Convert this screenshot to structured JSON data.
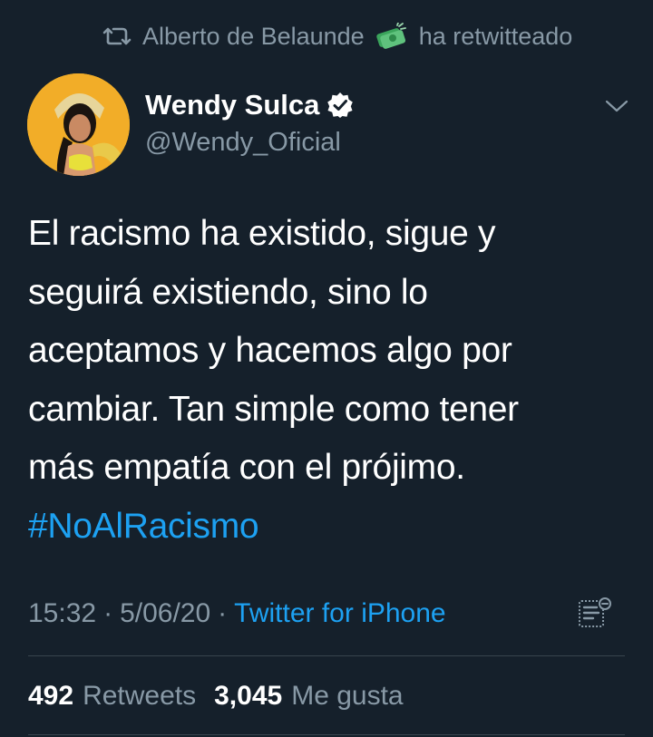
{
  "retweet_header": {
    "user": "Alberto de Belaunde",
    "action": "ha retwitteado"
  },
  "author": {
    "name": "Wendy Sulca",
    "handle": "@Wendy_Oficial",
    "verified": true
  },
  "tweet": {
    "lines": [
      "El racismo ha existido, sigue y",
      "seguirá existiendo, sino lo",
      "aceptamos y hacemos algo por",
      "cambiar. Tan simple como tener",
      "más empatía con el prójimo."
    ],
    "hashtag": "#NoAlRacismo"
  },
  "meta": {
    "time": "15:32",
    "date": "5/06/20",
    "source": "Twitter for iPhone",
    "separator": "·"
  },
  "stats": {
    "retweets_count": "492",
    "retweets_label": "Retweets",
    "likes_count": "3,045",
    "likes_label": "Me gusta"
  },
  "colors": {
    "background": "#15202b",
    "link": "#1da1f2",
    "secondary_text": "#8899a6"
  }
}
